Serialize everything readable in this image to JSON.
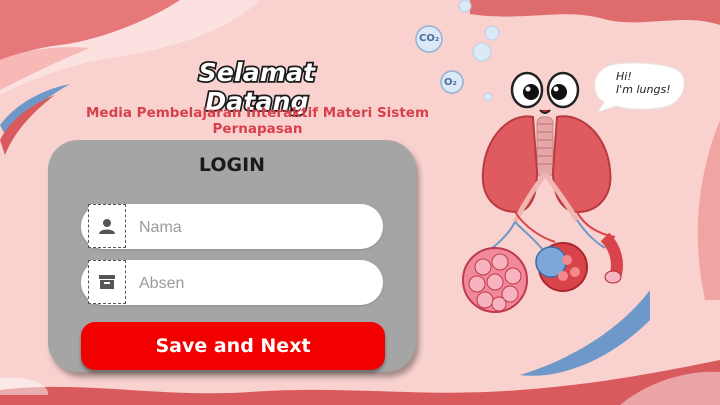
{
  "header": {
    "title": "Selamat Datang",
    "subtitle": "Media Pembelajaran Interaktif Materi Sistem Pernapasan"
  },
  "login": {
    "heading": "LOGIN",
    "name_placeholder": "Nama",
    "name_value": "",
    "absen_placeholder": "Absen",
    "absen_value": "",
    "submit_label": "Save and Next"
  },
  "illustration": {
    "speech_line1": "Hi!",
    "speech_line2": "I'm lungs!",
    "bubble_co2": "CO₂",
    "bubble_o2": "O₂"
  },
  "icons": {
    "name_field": "user-icon",
    "absen_field": "box-icon"
  },
  "colors": {
    "background": "#f9d2cf",
    "wave": "#d95a5c",
    "accent_blue": "#6d98c9",
    "card": "#a5a5a5",
    "button": "#f20000",
    "subtitle": "#d8404c"
  }
}
